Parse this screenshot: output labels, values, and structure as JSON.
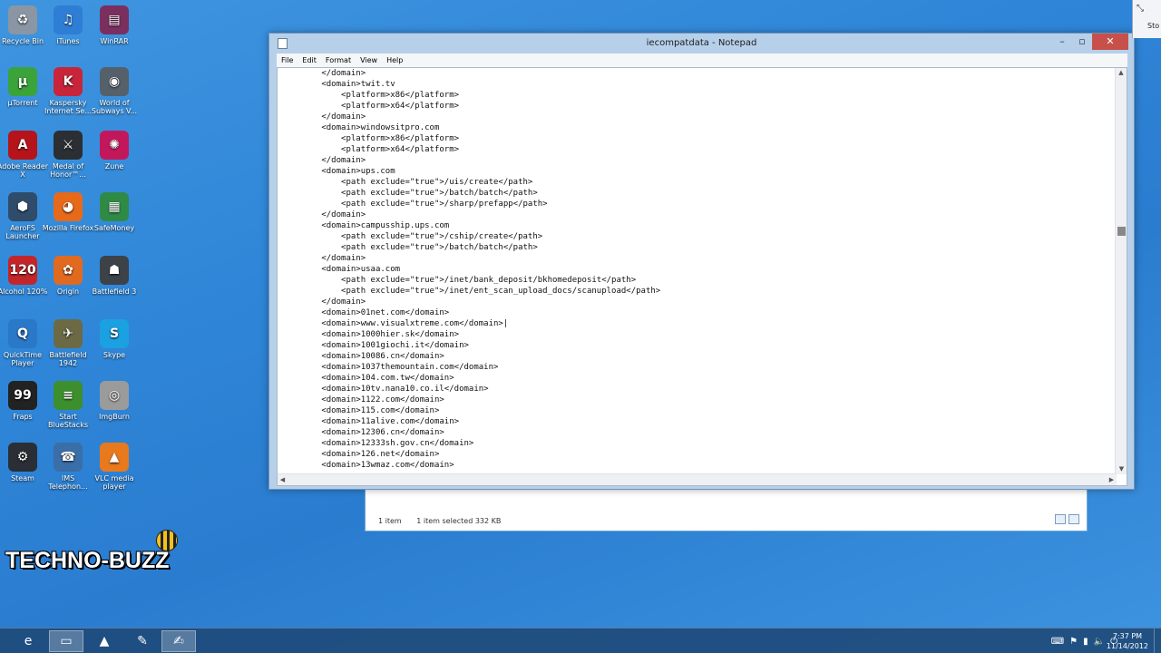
{
  "desktop": {
    "icons": [
      {
        "label": "Recycle Bin",
        "icon": "recycle-bin-icon",
        "color": "#8a96a3",
        "glyph": "♻"
      },
      {
        "label": "iTunes",
        "icon": "itunes-icon",
        "color": "#2e7ed6",
        "glyph": "♫"
      },
      {
        "label": "WinRAR",
        "icon": "winrar-icon",
        "color": "#7b2f5e",
        "glyph": "▤"
      },
      {
        "label": "µTorrent",
        "icon": "utorrent-icon",
        "color": "#3aa33a",
        "glyph": "µ"
      },
      {
        "label": "Kaspersky Internet Se...",
        "icon": "kaspersky-icon",
        "color": "#c8253a",
        "glyph": "K"
      },
      {
        "label": "World of Subways V...",
        "icon": "world-of-subways-icon",
        "color": "#55606b",
        "glyph": "◉"
      },
      {
        "label": "Adobe Reader X",
        "icon": "adobe-reader-icon",
        "color": "#b5141b",
        "glyph": "A"
      },
      {
        "label": "Medal of Honor™...",
        "icon": "medal-of-honor-icon",
        "color": "#2b2f33",
        "glyph": "⚔"
      },
      {
        "label": "Zune",
        "icon": "zune-icon",
        "color": "#c2185b",
        "glyph": "✺"
      },
      {
        "label": "AeroFS Launcher",
        "icon": "aerofs-icon",
        "color": "#2f4c6b",
        "glyph": "⬢"
      },
      {
        "label": "Mozilla Firefox",
        "icon": "firefox-icon",
        "color": "#e66a1a",
        "glyph": "◕"
      },
      {
        "label": "SafeMoney",
        "icon": "safemoney-icon",
        "color": "#2f8a46",
        "glyph": "▦"
      },
      {
        "label": "Alcohol 120%",
        "icon": "alcohol-icon",
        "color": "#c3262a",
        "glyph": "120"
      },
      {
        "label": "Origin",
        "icon": "origin-icon",
        "color": "#e06a20",
        "glyph": "✿"
      },
      {
        "label": "Battlefield 3",
        "icon": "battlefield3-icon",
        "color": "#3c4248",
        "glyph": "☗"
      },
      {
        "label": "QuickTime Player",
        "icon": "quicktime-icon",
        "color": "#2a78c8",
        "glyph": "Q"
      },
      {
        "label": "Battlefield 1942",
        "icon": "battlefield1942-icon",
        "color": "#6b6a45",
        "glyph": "✈"
      },
      {
        "label": "Skype",
        "icon": "skype-icon",
        "color": "#1ba0e1",
        "glyph": "S"
      },
      {
        "label": "Fraps",
        "icon": "fraps-icon",
        "color": "#222222",
        "glyph": "99"
      },
      {
        "label": "Start BlueStacks",
        "icon": "bluestacks-icon",
        "color": "#3c8f2c",
        "glyph": "≡"
      },
      {
        "label": "ImgBurn",
        "icon": "imgburn-icon",
        "color": "#9b9b9b",
        "glyph": "◎"
      },
      {
        "label": "Steam",
        "icon": "steam-icon",
        "color": "#2a2f36",
        "glyph": "⚙"
      },
      {
        "label": "IMS Telephon...",
        "icon": "ims-telephone-icon",
        "color": "#3a6ea8",
        "glyph": "☎"
      },
      {
        "label": "VLC media player",
        "icon": "vlc-icon",
        "color": "#e8791d",
        "glyph": "▲"
      }
    ],
    "watermark": "TECHNO-BUZZ"
  },
  "notepad": {
    "title": "iecompatdata - Notepad",
    "menu": [
      "File",
      "Edit",
      "Format",
      "View",
      "Help"
    ],
    "lines": [
      "        </domain>",
      "        <domain>twit.tv",
      "            <platform>x86</platform>",
      "            <platform>x64</platform>",
      "        </domain>",
      "        <domain>windowsitpro.com",
      "            <platform>x86</platform>",
      "            <platform>x64</platform>",
      "        </domain>",
      "        <domain>ups.com",
      "            <path exclude=\"true\">/uis/create</path>",
      "            <path exclude=\"true\">/batch/batch</path>",
      "            <path exclude=\"true\">/sharp/prefapp</path>",
      "        </domain>",
      "        <domain>campusship.ups.com",
      "            <path exclude=\"true\">/cship/create</path>",
      "            <path exclude=\"true\">/batch/batch</path>",
      "        </domain>",
      "        <domain>usaa.com",
      "            <path exclude=\"true\">/inet/bank_deposit/bkhomedeposit</path>",
      "            <path exclude=\"true\">/inet/ent_scan_upload_docs/scanupload</path>",
      "        </domain>",
      "        <domain>01net.com</domain>",
      "        <domain>www.visualxtreme.com</domain>|",
      "        <domain>1000hier.sk</domain>",
      "        <domain>1001giochi.it</domain>",
      "        <domain>10086.cn</domain>",
      "        <domain>1037themountain.com</domain>",
      "        <domain>104.com.tw</domain>",
      "        <domain>10tv.nana10.co.il</domain>",
      "        <domain>1122.com</domain>",
      "        <domain>115.com</domain>",
      "        <domain>11alive.com</domain>",
      "        <domain>12306.cn</domain>",
      "        <domain>12333sh.gov.cn</domain>",
      "        <domain>126.net</domain>",
      "        <domain>13wmaz.com</domain>"
    ]
  },
  "explorer": {
    "item_count": "1 item",
    "selected": "1 item selected  332 KB"
  },
  "right_window": {
    "label": "Sto"
  },
  "taskbar": {
    "buttons": [
      {
        "name": "internet-explorer-icon",
        "glyph": "e"
      },
      {
        "name": "file-explorer-icon",
        "glyph": "▭"
      },
      {
        "name": "vlc-taskbar-icon",
        "glyph": "▲"
      },
      {
        "name": "tool-taskbar-icon",
        "glyph": "✎"
      },
      {
        "name": "notepad-taskbar-icon",
        "glyph": "✍"
      }
    ],
    "time": "7:37 PM",
    "date": "11/14/2012"
  }
}
